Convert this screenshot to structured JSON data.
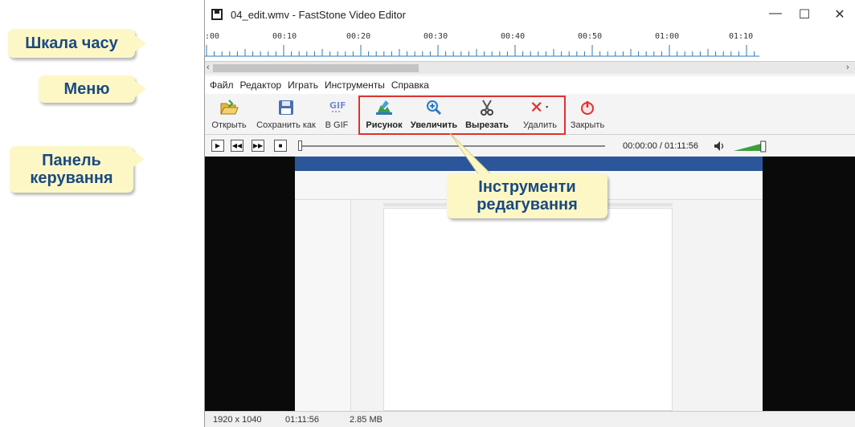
{
  "callouts": {
    "timeline": "Шкала часу",
    "menu": "Меню",
    "control_panel_line1": "Панель",
    "control_panel_line2": "керування",
    "edit_tools_line1": "Інструменти",
    "edit_tools_line2": "редагування"
  },
  "window": {
    "title": "04_edit.wmv - FastStone Video Editor",
    "minimize": "—",
    "maximize": "☐",
    "close": "✕"
  },
  "timeline": {
    "ticks": [
      ":00",
      "00:10",
      "00:20",
      "00:30",
      "00:40",
      "00:50",
      "01:00",
      "01:10"
    ]
  },
  "scrollbar": {
    "left_arrow": "‹",
    "right_arrow": "›"
  },
  "menu": {
    "items": [
      "Файл",
      "Редактор",
      "Играть",
      "Инструменты",
      "Справка"
    ]
  },
  "toolbar": {
    "open": "Открыть",
    "save_as": "Сохранить как",
    "to_gif": "В GIF",
    "picture": "Рисунок",
    "zoom": "Увеличить",
    "cut": "Вырезать",
    "delete": "Удалить",
    "close": "Закрыть"
  },
  "controls": {
    "play": "▶",
    "prev": "◀◀",
    "next": "▶▶",
    "stop": "■",
    "timecode": "00:00:00 / 01:11:56",
    "volume_icon": "speaker-icon",
    "volume_level": 0.8
  },
  "status": {
    "resolution": "1920 x 1040",
    "duration": "01:11:56",
    "size": "2.85 MB"
  },
  "colors": {
    "callout_bg": "#fdf7c6",
    "callout_text": "#1a4a80",
    "highlight": "#e03030"
  }
}
